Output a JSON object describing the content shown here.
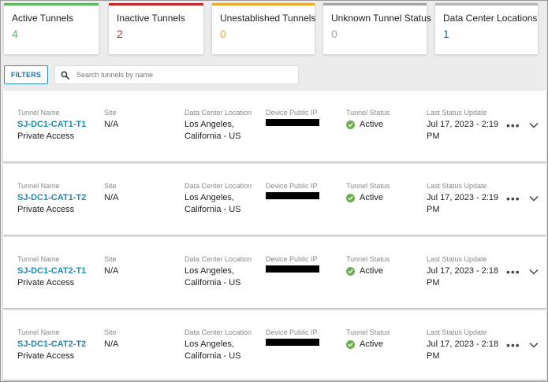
{
  "summary": {
    "cards": [
      {
        "label": "Active Tunnels",
        "count": "4",
        "color": "#5cb85c"
      },
      {
        "label": "Inactive Tunnels",
        "count": "2",
        "color": "#c0282d"
      },
      {
        "label": "Unestablished Tunnels",
        "count": "0",
        "color": "#e8a92f"
      },
      {
        "label": "Unknown Tunnel Status",
        "count": "0",
        "color": "#a3a3a3"
      },
      {
        "label": "Data Center Locations",
        "count": "1",
        "color": "#b5b5b5"
      }
    ]
  },
  "toolbar": {
    "filters_label": "FILTERS",
    "search_placeholder": "Search tunnels by name"
  },
  "columns": {
    "tunnel_name": "Tunnel Name",
    "site": "Site",
    "dc_location": "Data Center Location",
    "device_ip": "Device Public IP",
    "status": "Tunnel Status",
    "last_update": "Last Status Update"
  },
  "tunnels": [
    {
      "name": "SJ-DC1-CAT1-T1",
      "type": "Private Access",
      "site": "N/A",
      "location_line1": "Los Angeles,",
      "location_line2": "California - US",
      "status": "Active",
      "update_line1": "Jul 17, 2023 - 2:19",
      "update_line2": "PM"
    },
    {
      "name": "SJ-DC1-CAT1-T2",
      "type": "Private Access",
      "site": "N/A",
      "location_line1": "Los Angeles,",
      "location_line2": "California - US",
      "status": "Active",
      "update_line1": "Jul 17, 2023 - 2:19",
      "update_line2": "PM"
    },
    {
      "name": "SJ-DC1-CAT2-T1",
      "type": "Private Access",
      "site": "N/A",
      "location_line1": "Los Angeles,",
      "location_line2": "California - US",
      "status": "Active",
      "update_line1": "Jul 17, 2023 - 2:18",
      "update_line2": "PM"
    },
    {
      "name": "SJ-DC1-CAT2-T2",
      "type": "Private Access",
      "site": "N/A",
      "location_line1": "Los Angeles,",
      "location_line2": "California - US",
      "status": "Active",
      "update_line1": "Jul 17, 2023 - 2:18",
      "update_line2": "PM"
    }
  ],
  "icons": {
    "search": "search-icon",
    "status_active": "check-circle-icon",
    "more": "more-horizontal-icon",
    "expand": "chevron-down-icon"
  }
}
